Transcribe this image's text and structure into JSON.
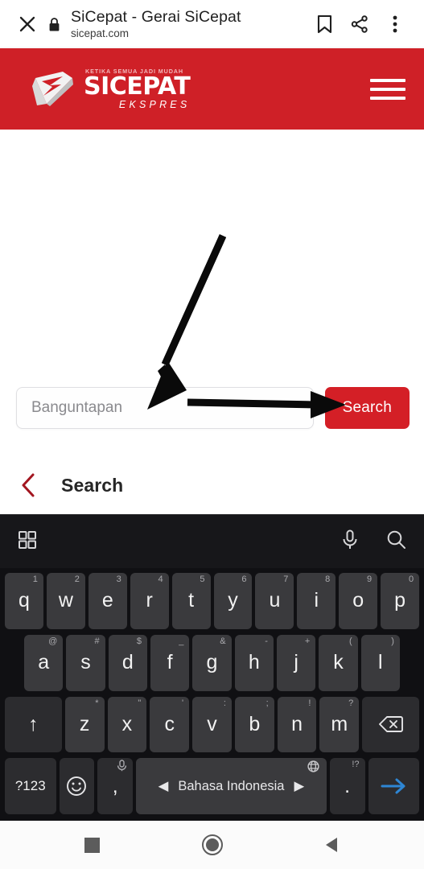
{
  "browser_bar": {
    "close_label": "✕",
    "lock_icon": "lock-icon",
    "title": "SiCepat - Gerai SiCepat",
    "url": "sicepat.com",
    "icons": [
      "bookmark-icon",
      "share-icon",
      "more-vertical-icon"
    ]
  },
  "site_header": {
    "tagline": "KETIKA SEMUA JADI MUDAH",
    "brand": "SICEPAT",
    "brand_sub": "EKSPRES",
    "menu_icon": "hamburger-menu-icon",
    "background": "#cf2027"
  },
  "search": {
    "input_placeholder": "Banguntapan",
    "input_value": "",
    "button_label": "Search",
    "button_color": "#d41f26"
  },
  "search_section": {
    "back_icon": "chevron-left-icon",
    "back_icon_color": "#a31620",
    "heading": "Search"
  },
  "keyboard": {
    "toolbar": {
      "left_icon": "grid-apps-icon",
      "mic_icon": "microphone-icon",
      "search_icon": "search-icon"
    },
    "rows": [
      [
        {
          "label": "q",
          "hint": "1"
        },
        {
          "label": "w",
          "hint": "2"
        },
        {
          "label": "e",
          "hint": "3"
        },
        {
          "label": "r",
          "hint": "4"
        },
        {
          "label": "t",
          "hint": "5"
        },
        {
          "label": "y",
          "hint": "6"
        },
        {
          "label": "u",
          "hint": "7"
        },
        {
          "label": "i",
          "hint": "8"
        },
        {
          "label": "o",
          "hint": "9"
        },
        {
          "label": "p",
          "hint": "0"
        }
      ],
      [
        {
          "label": "a",
          "hint": "@"
        },
        {
          "label": "s",
          "hint": "#"
        },
        {
          "label": "d",
          "hint": "$"
        },
        {
          "label": "f",
          "hint": "_"
        },
        {
          "label": "g",
          "hint": "&"
        },
        {
          "label": "h",
          "hint": "-"
        },
        {
          "label": "j",
          "hint": "+"
        },
        {
          "label": "k",
          "hint": "("
        },
        {
          "label": "l",
          "hint": ")"
        }
      ],
      [
        {
          "label": "↑",
          "hint": "",
          "name": "shift-key"
        },
        {
          "label": "z",
          "hint": "*"
        },
        {
          "label": "x",
          "hint": "\""
        },
        {
          "label": "c",
          "hint": "'"
        },
        {
          "label": "v",
          "hint": ":"
        },
        {
          "label": "b",
          "hint": ";"
        },
        {
          "label": "n",
          "hint": "!"
        },
        {
          "label": "m",
          "hint": "?"
        },
        {
          "label": "⌫",
          "hint": "",
          "name": "backspace-key"
        }
      ],
      [
        {
          "label": "?123",
          "hint": "",
          "name": "symbols-key"
        },
        {
          "label": "☺",
          "hint": "",
          "name": "emoji-key"
        },
        {
          "label": ",",
          "hint": "mic",
          "name": "comma-key"
        },
        {
          "label": "Bahasa Indonesia",
          "hint": "globe",
          "name": "space-key"
        },
        {
          "label": ".",
          "hint": "!?",
          "name": "period-key"
        },
        {
          "label": "→",
          "hint": "",
          "name": "enter-key"
        }
      ]
    ],
    "space_prev": "◀",
    "space_next": "▶"
  },
  "navbar": {
    "recents": "recents-square-icon",
    "home": "home-circle-icon",
    "back": "back-triangle-icon"
  },
  "annotations": {
    "arrow_to_input": "diagonal-arrow-pointing-to-search-input",
    "arrow_to_button": "horizontal-arrow-pointing-to-search-button"
  }
}
